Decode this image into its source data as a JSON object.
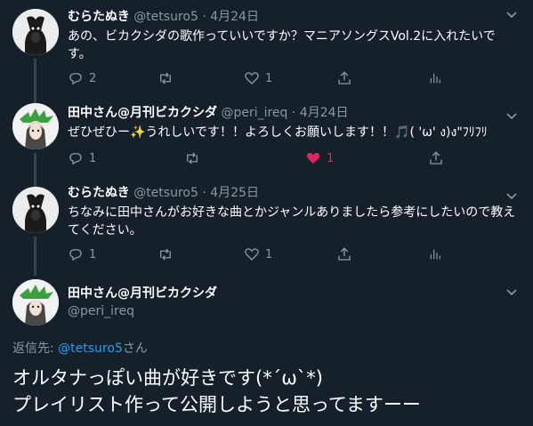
{
  "tweets": [
    {
      "name": "むらたぬき",
      "handle": "@tetsuro5",
      "date": "4月24日",
      "text": "あの、ビカクシダの歌作っていいですか？マニアソングスVol.2に入れたいです。",
      "replies": "2",
      "retweets": "",
      "likes": "1"
    },
    {
      "name": "田中さん@月刊ビカクシダ",
      "handle": "@peri_ireq",
      "date": "4月24日",
      "text": "ぜひぜひー✨うれしいです！！よろしくお願いします！！🎵( 'ω' ง)ง\"ﾌﾘﾌﾘ",
      "replies": "1",
      "retweets": "",
      "likes": "1"
    },
    {
      "name": "むらたぬき",
      "handle": "@tetsuro5",
      "date": "4月25日",
      "text": "ちなみに田中さんがお好きな曲とかジャンルありましたら参考にしたいので教えてください。",
      "replies": "1",
      "retweets": "",
      "likes": "1"
    }
  ],
  "main_tweet": {
    "name": "田中さん@月刊ビカクシダ",
    "handle": "@peri_ireq",
    "reply_label": "返信先:",
    "reply_handle": "@tetsuro5",
    "reply_suffix": "さん",
    "line1": "オルタナっぽい曲が好きです(*´ω`*)",
    "line2": "プレイリスト作って公開しようと思ってますーー"
  },
  "colors": {
    "background": "#15202b",
    "muted": "#8899a6",
    "link": "#1da1f2",
    "liked": "#e0245e",
    "thread_line": "#38444d"
  },
  "icons": [
    "reply-icon",
    "retweet-icon",
    "like-icon",
    "share-icon",
    "analytics-icon",
    "chevron-down-icon"
  ]
}
